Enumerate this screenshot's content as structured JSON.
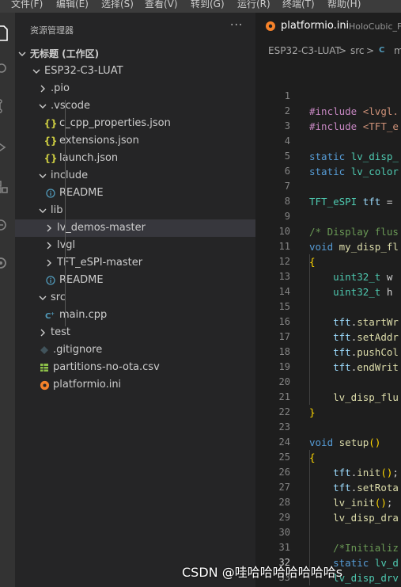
{
  "menu": [
    "文件(F)",
    "编辑(E)",
    "选择(S)",
    "查看(V)",
    "转到(G)",
    "运行(R)",
    "终端(T)",
    "帮助(H)"
  ],
  "explorer": {
    "title": "资源管理器",
    "more": "···",
    "workspace": "无标题 (工作区)",
    "tree": [
      {
        "label": "ESP32-C3-LUAT",
        "kind": "folder-open"
      },
      {
        "label": ".pio",
        "kind": "folder"
      },
      {
        "label": ".vscode",
        "kind": "folder-open"
      },
      {
        "label": "c_cpp_properties.json",
        "kind": "json"
      },
      {
        "label": "extensions.json",
        "kind": "json"
      },
      {
        "label": "launch.json",
        "kind": "json"
      },
      {
        "label": "include",
        "kind": "folder-open"
      },
      {
        "label": "README",
        "kind": "info"
      },
      {
        "label": "lib",
        "kind": "folder-open"
      },
      {
        "label": "lv_demos-master",
        "kind": "folder"
      },
      {
        "label": "lvgl",
        "kind": "folder"
      },
      {
        "label": "TFT_eSPI-master",
        "kind": "folder"
      },
      {
        "label": "README",
        "kind": "info"
      },
      {
        "label": "src",
        "kind": "folder-open"
      },
      {
        "label": "main.cpp",
        "kind": "cpp"
      },
      {
        "label": "test",
        "kind": "folder"
      },
      {
        "label": ".gitignore",
        "kind": "git"
      },
      {
        "label": "partitions-no-ota.csv",
        "kind": "csv"
      },
      {
        "label": "platformio.ini",
        "kind": "pio"
      }
    ]
  },
  "editor": {
    "tab": {
      "label": "platformio.ini",
      "description": "HoloCubic_Fir"
    },
    "breadcrumb": [
      "ESP32-C3-LUAT",
      ">",
      "src",
      ">",
      "m"
    ],
    "line_numbers": [
      "1",
      "2",
      "3",
      "4",
      "5",
      "6",
      "7",
      "8",
      "9",
      "10",
      "11",
      "12",
      "13",
      "14",
      "15",
      "16",
      "17",
      "18",
      "19",
      "20",
      "21",
      "22",
      "23",
      "24",
      "25",
      "26",
      "27",
      "28",
      "29",
      "30",
      "31",
      "32",
      "33"
    ],
    "active_line": "32",
    "code": [
      "",
      "#include <lvgl.",
      "#include <TFT_e",
      "",
      "static lv_disp_",
      "static lv_color",
      "",
      "TFT_eSPI tft = ",
      "",
      "/* Display flus",
      "void my_disp_fl",
      "{",
      "    uint32_t w",
      "    uint32_t h",
      "",
      "    tft.startWr",
      "    tft.setAddr",
      "    tft.pushCol",
      "    tft.endWrit",
      "",
      "    lv_disp_flu",
      "}",
      "",
      "void setup()",
      "{",
      "    tft.init();",
      "    tft.setRota",
      "    lv_init();",
      "    lv_disp_dra",
      "",
      "    /*Initializ",
      "    static lv_d",
      "    lv_disp_drv"
    ]
  },
  "watermark": "CSDN @哇哈哈哈哈哈哈哈s",
  "colors": {
    "accent": "#007acc",
    "background": "#1e1e1e",
    "sidebar": "#252526",
    "activity": "#333333"
  }
}
